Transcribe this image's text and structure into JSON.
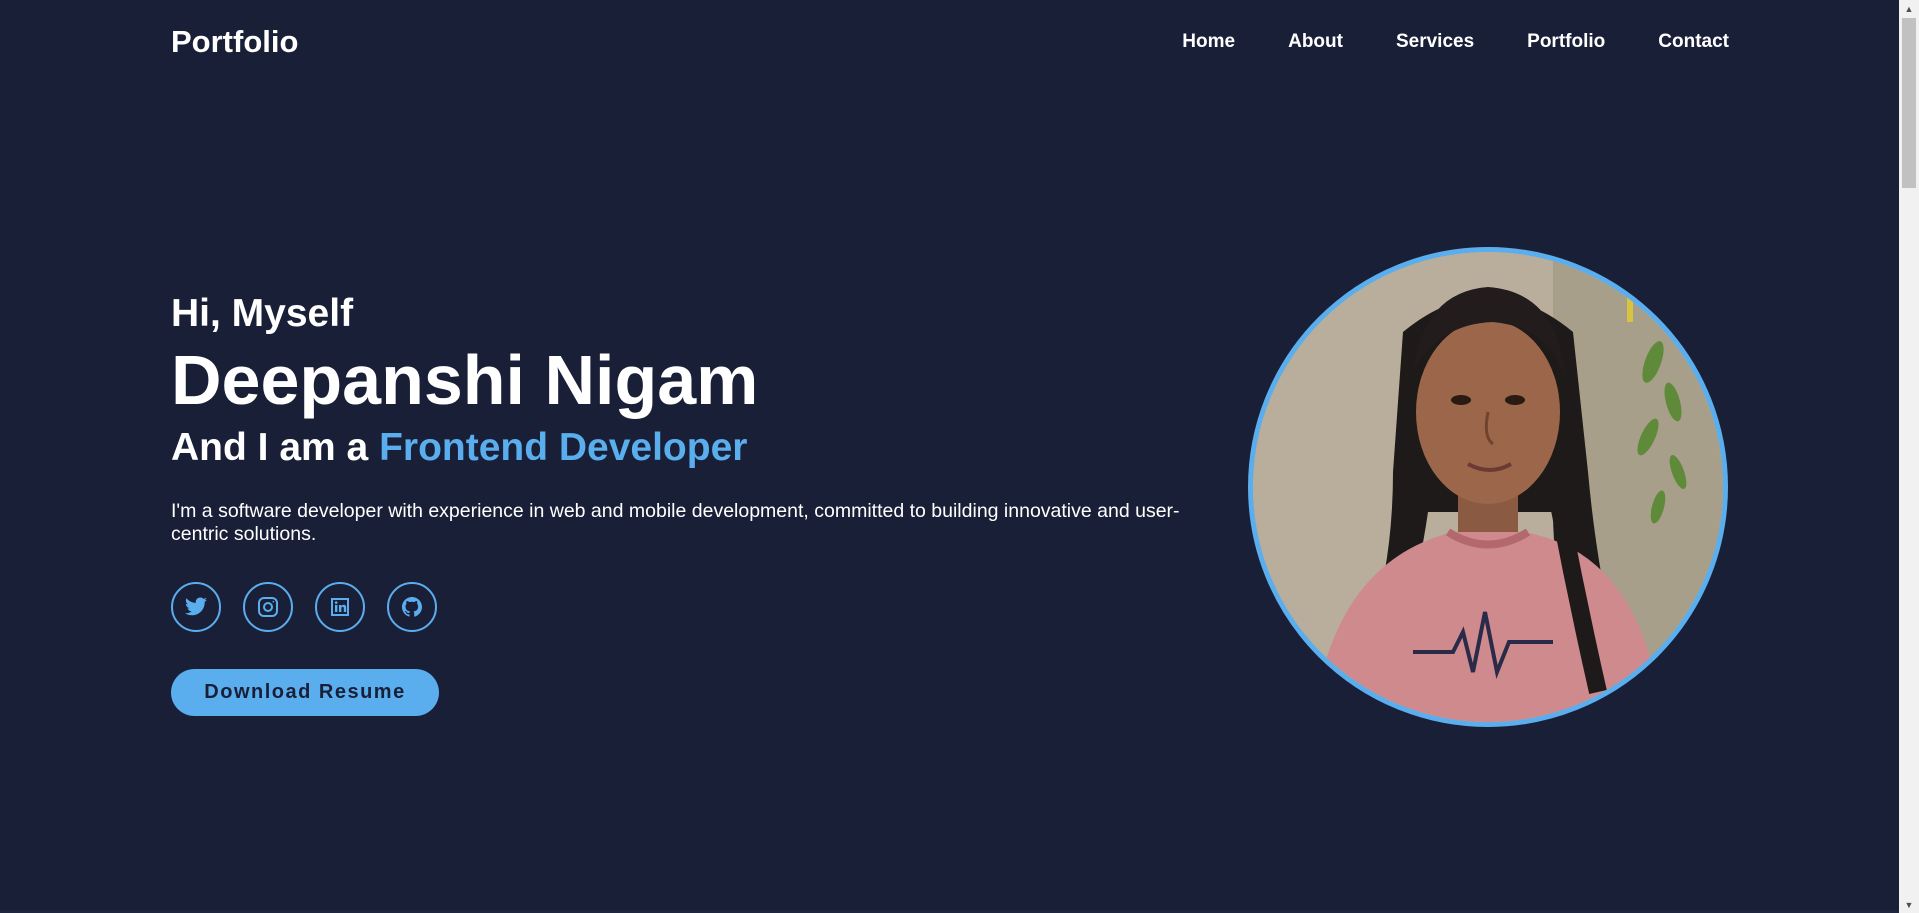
{
  "header": {
    "logo": "Portfolio",
    "nav": [
      {
        "label": "Home"
      },
      {
        "label": "About"
      },
      {
        "label": "Services"
      },
      {
        "label": "Portfolio"
      },
      {
        "label": "Contact"
      }
    ]
  },
  "hero": {
    "greeting": "Hi, Myself",
    "name": "Deepanshi Nigam",
    "role_prefix": "And I am a",
    "role_highlight": "Frontend Developer",
    "bio": "I'm a software developer with experience in web and mobile development, committed to building innovative and user-centric solutions.",
    "socials": [
      {
        "icon": "twitter-icon"
      },
      {
        "icon": "instagram-icon"
      },
      {
        "icon": "linkedin-icon"
      },
      {
        "icon": "github-icon"
      }
    ],
    "resume_button": "Download Resume"
  },
  "colors": {
    "background": "#1a1f38",
    "accent": "#5aaeee",
    "text": "#ffffff"
  }
}
